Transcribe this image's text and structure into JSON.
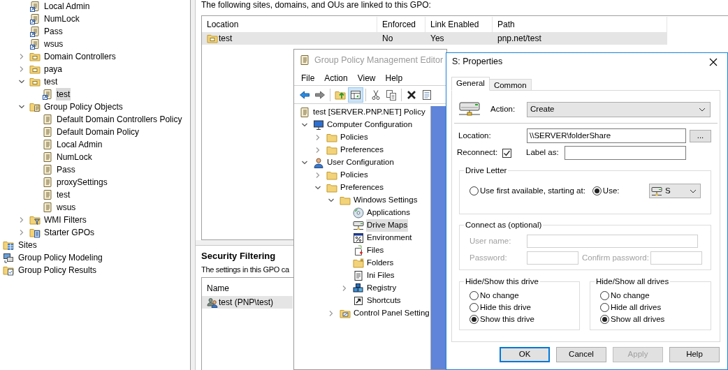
{
  "main_tree": {
    "items": [
      {
        "children": [
          {
            "label": "Local Admin",
            "kind": "link",
            "selected": false
          },
          {
            "label": "NumLock",
            "kind": "link",
            "selected": false
          },
          {
            "label": "Pass",
            "kind": "link",
            "selected": false
          },
          {
            "label": "wsus",
            "kind": "link",
            "selected": false
          },
          {
            "label": "Domain Controllers",
            "kind": "ou",
            "expanded": false,
            "selected": false
          },
          {
            "label": "paya",
            "kind": "ou",
            "expanded": false,
            "selected": false
          },
          {
            "label": "test",
            "kind": "ou",
            "expanded": true,
            "selected": false,
            "children": [
              {
                "label": "test",
                "kind": "link",
                "selected": true
              }
            ]
          },
          {
            "label": "Group Policy Objects",
            "kind": "gpo_folder",
            "expanded": true,
            "selected": false,
            "children": [
              {
                "label": "Default Domain Controllers Policy",
                "kind": "gpo",
                "selected": false
              },
              {
                "label": "Default Domain Policy",
                "kind": "gpo",
                "selected": false
              },
              {
                "label": "Local Admin",
                "kind": "gpo",
                "selected": false
              },
              {
                "label": "NumLock",
                "kind": "gpo",
                "selected": false
              },
              {
                "label": "Pass",
                "kind": "gpo",
                "selected": false
              },
              {
                "label": "proxySettings",
                "kind": "gpo",
                "selected": false
              },
              {
                "label": "test",
                "kind": "gpo",
                "selected": false
              },
              {
                "label": "wsus",
                "kind": "gpo",
                "selected": false
              }
            ]
          },
          {
            "label": "WMI Filters",
            "kind": "wmi",
            "expanded": false,
            "selected": false
          },
          {
            "label": "Starter GPOs",
            "kind": "starter",
            "expanded": false,
            "selected": false
          }
        ]
      },
      {
        "label": "Sites",
        "kind": "sites",
        "selected": false
      },
      {
        "label": "Group Policy Modeling",
        "kind": "modeling",
        "selected": false
      },
      {
        "label": "Group Policy Results",
        "kind": "results",
        "selected": false
      }
    ]
  },
  "links": {
    "caption": "The following sites, domains, and OUs are linked to this GPO:",
    "columns": [
      "Location",
      "Enforced",
      "Link Enabled",
      "Path"
    ],
    "rows": [
      {
        "kind": "ou",
        "cells": [
          "test",
          "No",
          "Yes",
          "pnp.net/test"
        ],
        "selected": true
      }
    ]
  },
  "security_filtering": {
    "title": "Security Filtering",
    "caption": "The settings in this GPO ca",
    "columns": [
      "Name"
    ],
    "rows": [
      {
        "kind": "group",
        "cells": [
          "test (PNP\\test)"
        ],
        "selected": true
      }
    ]
  },
  "editor": {
    "title": "Group Policy Management Editor",
    "active": false,
    "menu": [
      "File",
      "Action",
      "View",
      "Help"
    ],
    "toolbar": [
      {
        "kind": "back",
        "pressed": false
      },
      {
        "kind": "forward",
        "pressed": false
      },
      {
        "kind": "separator"
      },
      {
        "kind": "up",
        "pressed": false
      },
      {
        "kind": "pane",
        "pressed": true
      },
      {
        "kind": "separator"
      },
      {
        "kind": "cut",
        "pressed": false
      },
      {
        "kind": "copy",
        "pressed": false
      },
      {
        "kind": "separator"
      },
      {
        "kind": "delete",
        "pressed": false
      },
      {
        "kind": "properties",
        "pressed": false
      }
    ],
    "tree": [
      {
        "label": "test [SERVER.PNP.NET] Policy",
        "kind": "gpo",
        "selected": false,
        "children": [
          {
            "label": "Computer Configuration",
            "kind": "computer",
            "expanded": true,
            "selected": false,
            "children": [
              {
                "label": "Policies",
                "kind": "folder",
                "expanded": false,
                "selected": false
              },
              {
                "label": "Preferences",
                "kind": "folder",
                "expanded": false,
                "selected": false
              }
            ]
          },
          {
            "label": "User Configuration",
            "kind": "user",
            "expanded": true,
            "selected": false,
            "children": [
              {
                "label": "Policies",
                "kind": "folder",
                "expanded": false,
                "selected": false
              },
              {
                "label": "Preferences",
                "kind": "folder",
                "expanded": true,
                "selected": false,
                "children": [
                  {
                    "label": "Windows Settings",
                    "kind": "folder",
                    "expanded": true,
                    "selected": false,
                    "children": [
                      {
                        "label": "Applications",
                        "kind": "disc",
                        "selected": false
                      },
                      {
                        "label": "Drive Maps",
                        "kind": "drive",
                        "selected": true
                      },
                      {
                        "label": "Environment",
                        "kind": "percent",
                        "selected": false
                      },
                      {
                        "label": "Files",
                        "kind": "files",
                        "selected": false
                      },
                      {
                        "label": "Folders",
                        "kind": "folders",
                        "selected": false
                      },
                      {
                        "label": "Ini Files",
                        "kind": "ini",
                        "selected": false
                      },
                      {
                        "label": "Registry",
                        "kind": "registry",
                        "expanded": false,
                        "selected": false
                      },
                      {
                        "label": "Shortcuts",
                        "kind": "shortcut",
                        "selected": false
                      }
                    ]
                  },
                  {
                    "label": "Control Panel Setting",
                    "kind": "control",
                    "expanded": false,
                    "selected": false
                  }
                ]
              }
            ]
          }
        ]
      }
    ]
  },
  "properties": {
    "title": "S: Properties",
    "active": true,
    "tabs": [
      {
        "label": "General",
        "selected": true
      },
      {
        "label": "Common",
        "selected": false
      }
    ],
    "action": {
      "label": "Action:",
      "value": "Create"
    },
    "location": {
      "label": "Location:",
      "value": "\\\\SERVER\\folderShare",
      "browse": "..."
    },
    "reconnect": {
      "label": "Reconnect:",
      "checked": true
    },
    "label_as": {
      "label": "Label as:"
    },
    "drive_letter": {
      "title": "Drive Letter",
      "options": [
        {
          "label": "Use first available, starting at:",
          "selected": false
        },
        {
          "label": "Use:",
          "selected": true
        }
      ],
      "drive": "S"
    },
    "connect_as": {
      "title": "Connect as (optional)",
      "disabled": true,
      "user_name": "User name:",
      "password": "Password:",
      "confirm_password": "Confirm password:"
    },
    "hide_show_this": {
      "title": "Hide/Show this drive",
      "options": [
        {
          "label": "No change",
          "selected": false
        },
        {
          "label": "Hide this drive",
          "selected": false
        },
        {
          "label": "Show this drive",
          "selected": true
        }
      ]
    },
    "hide_show_all": {
      "title": "Hide/Show all drives",
      "options": [
        {
          "label": "No change",
          "selected": false
        },
        {
          "label": "Hide all drives",
          "selected": false
        },
        {
          "label": "Show all drives",
          "selected": true
        }
      ]
    },
    "buttons": [
      {
        "label": "OK",
        "default": true,
        "disabled": false
      },
      {
        "label": "Cancel",
        "default": false,
        "disabled": false
      },
      {
        "label": "Apply",
        "default": false,
        "disabled": true
      },
      {
        "label": "Help",
        "default": false,
        "disabled": false
      }
    ]
  }
}
